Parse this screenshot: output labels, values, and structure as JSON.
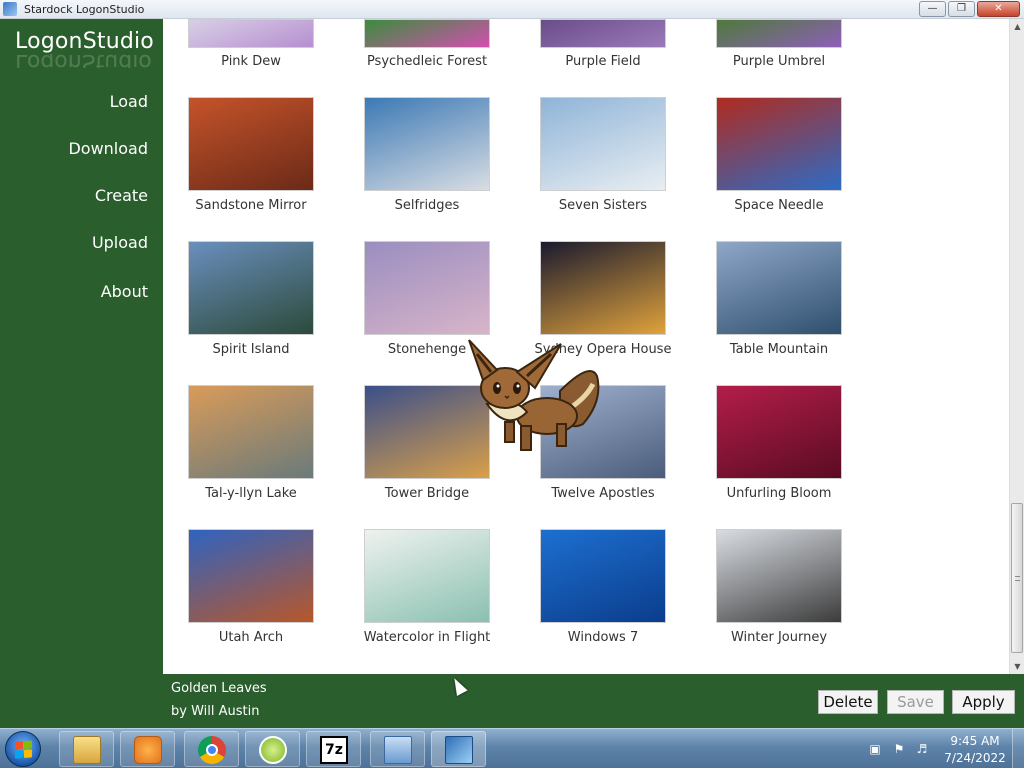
{
  "window": {
    "title": "Stardock LogonStudio"
  },
  "sidebar": {
    "logo": "LogonStudio",
    "items": [
      {
        "label": "Load"
      },
      {
        "label": "Download"
      },
      {
        "label": "Create"
      },
      {
        "label": "Upload"
      },
      {
        "label": "About"
      }
    ]
  },
  "gallery": {
    "rows": [
      [
        {
          "name": "Pink Dew",
          "colors": [
            "#d8cfe6",
            "#b78fd0"
          ]
        },
        {
          "name": "Psychedleic Forest",
          "colors": [
            "#3b8d3c",
            "#d34fb0"
          ]
        },
        {
          "name": "Purple Field",
          "colors": [
            "#6b4c8a",
            "#9a7ab8"
          ]
        },
        {
          "name": "Purple Umbrel",
          "colors": [
            "#4e7a3b",
            "#8e5fb8"
          ]
        }
      ],
      [
        {
          "name": "Sandstone Mirror",
          "colors": [
            "#c5532a",
            "#6b2a18"
          ]
        },
        {
          "name": "Selfridges",
          "colors": [
            "#3c79b5",
            "#d8dde3"
          ]
        },
        {
          "name": "Seven Sisters",
          "colors": [
            "#8fb4d8",
            "#e8eef2"
          ]
        },
        {
          "name": "Space Needle",
          "colors": [
            "#b02b1f",
            "#2d6bc5"
          ]
        }
      ],
      [
        {
          "name": "Spirit Island",
          "colors": [
            "#6a8fbd",
            "#2c4a3b"
          ]
        },
        {
          "name": "Stonehenge",
          "colors": [
            "#9a8ec0",
            "#d8b4c9"
          ]
        },
        {
          "name": "Sydney Opera House",
          "colors": [
            "#1a1a2e",
            "#e0a23c"
          ]
        },
        {
          "name": "Table Mountain",
          "colors": [
            "#8fa7c9",
            "#2f4f6e"
          ]
        }
      ],
      [
        {
          "name": "Tal-y-llyn Lake",
          "colors": [
            "#d99b5a",
            "#6a7a7a"
          ]
        },
        {
          "name": "Tower Bridge",
          "colors": [
            "#3b4f8a",
            "#d9a04a"
          ]
        },
        {
          "name": "Twelve Apostles",
          "colors": [
            "#9fb0cf",
            "#4a5d7a"
          ]
        },
        {
          "name": "Unfurling Bloom",
          "colors": [
            "#b31d4a",
            "#5a0c22"
          ]
        }
      ],
      [
        {
          "name": "Utah Arch",
          "colors": [
            "#2f63c0",
            "#b8572a"
          ]
        },
        {
          "name": "Watercolor in Flight",
          "colors": [
            "#eef2ef",
            "#8ac0b0"
          ]
        },
        {
          "name": "Windows 7",
          "colors": [
            "#1d6fd0",
            "#0b3d8c"
          ]
        },
        {
          "name": "Winter Journey",
          "colors": [
            "#d9dde3",
            "#3c3c3c"
          ]
        }
      ]
    ]
  },
  "selection": {
    "name": "Golden Leaves",
    "author": "by Will Austin"
  },
  "buttons": {
    "delete": "Delete",
    "save": "Save",
    "apply": "Apply"
  },
  "taskbar": {
    "items": [
      {
        "icon": "file-explorer-icon",
        "label": ""
      },
      {
        "icon": "media-player-icon",
        "label": ""
      },
      {
        "icon": "chrome-icon",
        "label": ""
      },
      {
        "icon": "green-app-icon",
        "label": ""
      },
      {
        "icon": "7zip-icon",
        "label": "7z"
      },
      {
        "icon": "control-panel-icon",
        "label": ""
      },
      {
        "icon": "logonstudio-icon",
        "label": ""
      }
    ],
    "clock": {
      "time": "9:45 AM",
      "date": "7/24/2022"
    }
  }
}
